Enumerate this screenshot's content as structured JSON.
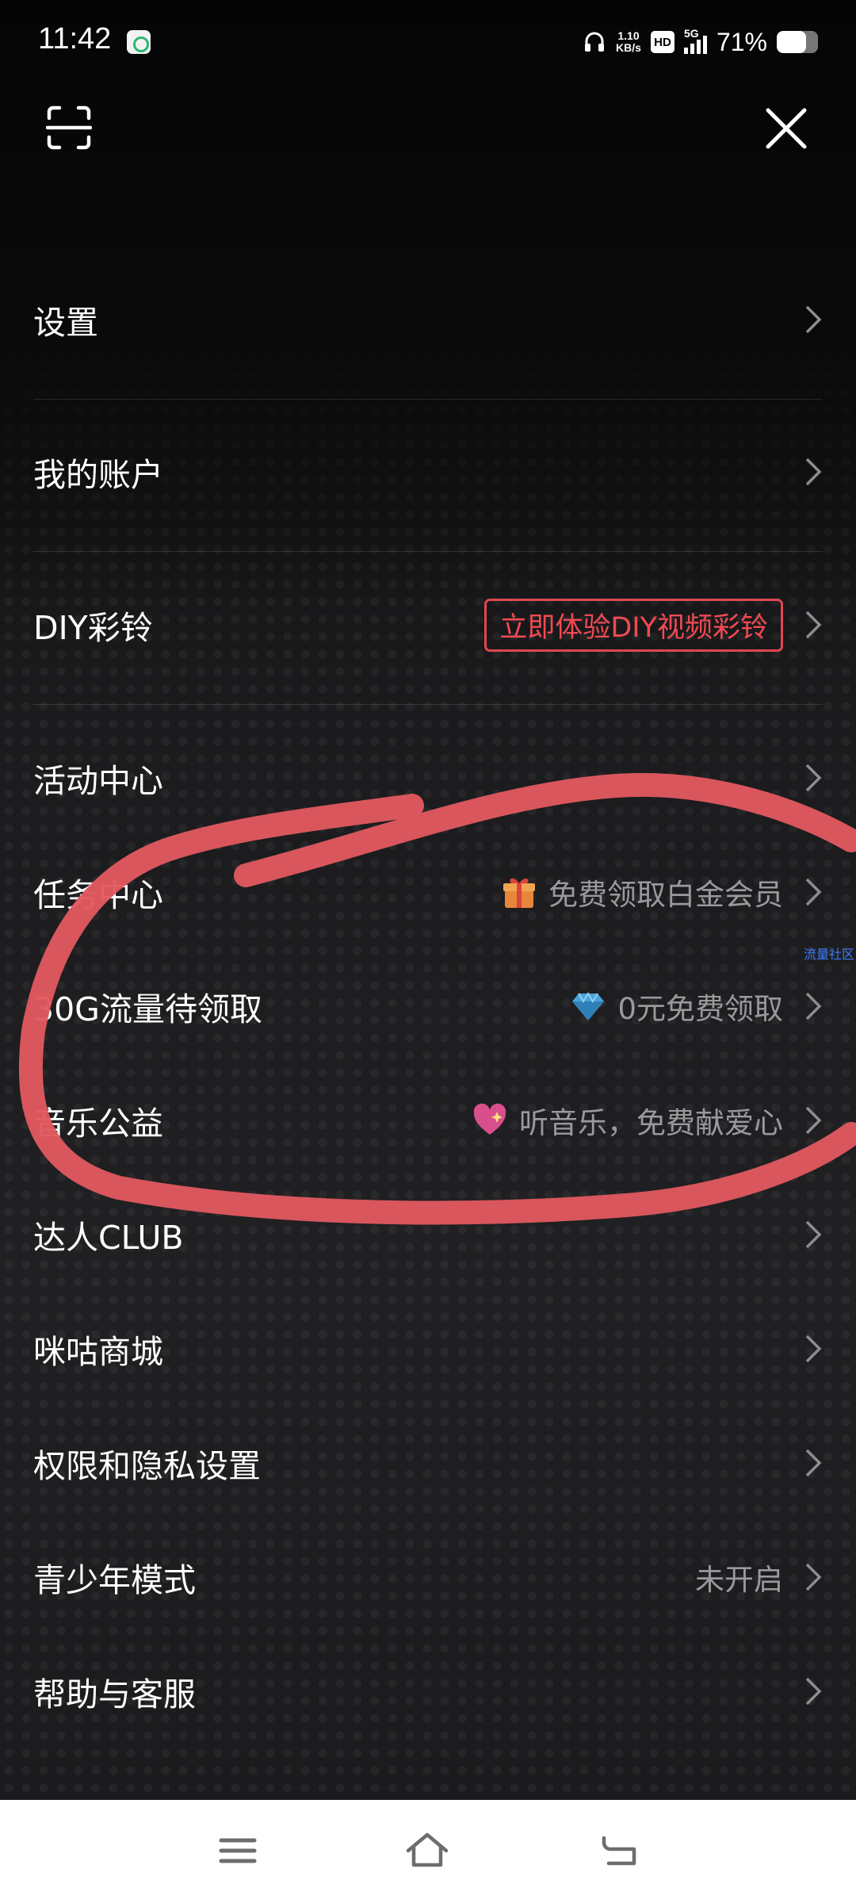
{
  "status_bar": {
    "time": "11:42",
    "net_speed_value": "1.10",
    "net_speed_unit": "KB/s",
    "hd": "HD",
    "network": "5G",
    "battery": "71%",
    "battery_level": 0.71
  },
  "header": {
    "scan_icon": "scan-icon",
    "close_icon": "close-icon"
  },
  "menu": {
    "items": [
      {
        "label": "设置"
      },
      {
        "label": "我的账户"
      },
      {
        "label": "DIY彩铃",
        "badge": "立即体验DIY视频彩铃"
      },
      {
        "label": "活动中心"
      },
      {
        "label": "任务中心",
        "hint": "免费领取白金会员",
        "icon": "gift-icon"
      },
      {
        "label": "30G流量待领取",
        "hint": "0元免费领取",
        "icon": "diamond-icon"
      },
      {
        "label": "音乐公益",
        "hint": "听音乐，免费献爱心",
        "icon": "heart-icon"
      },
      {
        "label": "达人CLUB"
      },
      {
        "label": "咪咕商城"
      },
      {
        "label": "权限和隐私设置"
      },
      {
        "label": "青少年模式",
        "hint": "未开启"
      },
      {
        "label": "帮助与客服"
      }
    ]
  },
  "side_tag": "流量社区",
  "colors": {
    "accent": "#e0474f",
    "annotation_stroke": "#e0585f",
    "hint_text": "#9a9a9d",
    "background": "#19191b"
  },
  "nav_bar": {
    "menu_icon": "menu-icon",
    "home_icon": "home-icon",
    "back_icon": "back-icon"
  }
}
